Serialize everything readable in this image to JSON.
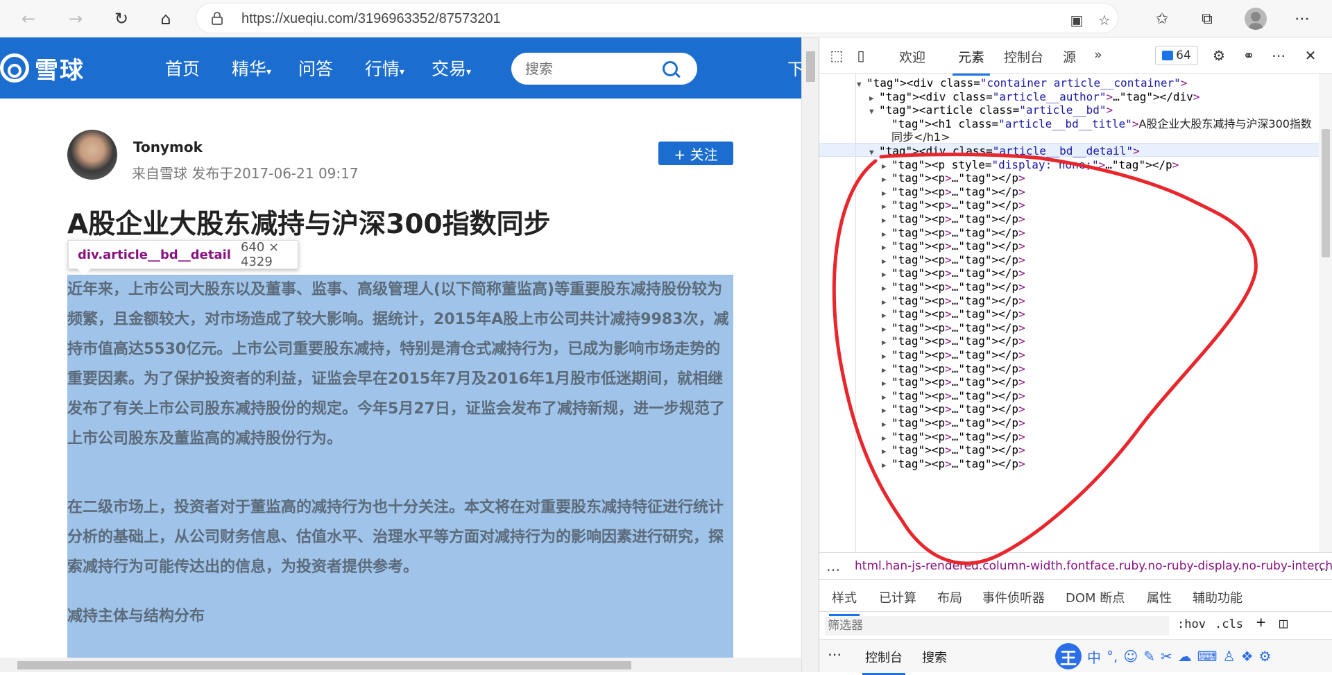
{
  "browser": {
    "url": "https://xueqiu.com/3196963352/87573201"
  },
  "site": {
    "logo_text": "雪球",
    "nav": [
      "首页",
      "精华",
      "问答",
      "行情",
      "交易"
    ],
    "nav_has_dropdown": [
      false,
      true,
      false,
      true,
      true
    ],
    "search_placeholder": "搜索",
    "header_clip": "下"
  },
  "article": {
    "author": "Tonymok",
    "meta": "来自雪球  发布于2017-06-21 09:17",
    "follow_label": "+ 关注",
    "title": "A股企业大股东减持与沪深300指数同步",
    "paragraphs": [
      "近年来，上市公司大股东以及董事、监事、高级管理人(以下简称董监高)等重要股东减持股份较为频繁，且金额较大，对市场造成了较大影响。据统计，2015年A股上市公司共计减持9983次，减持市值高达5530亿元。上市公司重要股东减持，特别是清仓式减持行为，已成为影响市场走势的重要因素。为了保护投资者的利益，证监会早在2015年7月及2016年1月股市低迷期间，就相继发布了有关上市公司股东减持股份的规定。今年5月27日，证监会发布了减持新规，进一步规范了上市公司股东及董监高的减持股份行为。",
      "在二级市场上，投资者对于董监高的减持行为也十分关注。本文将在对重要股东减持特征进行统计分析的基础上，从公司财务信息、估值水平、治理水平等方面对减持行为的影响因素进行研究，探索减持行为可能传达出的信息，为投资者提供参考。",
      "减持主体与结构分布"
    ]
  },
  "inspector_tooltip": {
    "selector": "div.article__bd__detail",
    "size": "640 × 4329"
  },
  "devtools": {
    "tabs": [
      "欢迎",
      "元素",
      "控制台",
      "源"
    ],
    "active_tab": "元素",
    "more": "»",
    "issues_count": "64",
    "dom_lines": [
      {
        "indent": 0,
        "arrow": "▼",
        "html": "<div class=\"container article__container\">"
      },
      {
        "indent": 1,
        "arrow": "▶",
        "html": "<div class=\"article__author\">…</div>"
      },
      {
        "indent": 1,
        "arrow": "▼",
        "html": "<article class=\"article__bd\">"
      },
      {
        "indent": 2,
        "arrow": "",
        "html": "<h1 class=\"article__bd__title\">",
        "text": "A股企业大股东减持与沪深300指数"
      },
      {
        "indent": 2,
        "arrow": "",
        "html": "",
        "text": "同步</h1>"
      },
      {
        "indent": 1,
        "arrow": "▼",
        "html": "<div class=\"article__bd__detail\">"
      },
      {
        "indent": 2,
        "arrow": "▶",
        "html": "<p style=\"display: none;\">…</p>"
      }
    ],
    "p_collapsed": "<p>…</p>",
    "p_count": 22,
    "breadcrumb": "html.han-js-rendered.column-width.fontface.ruby.no-ruby-display.no-ruby-intercha",
    "breadcrumb_dots": "…",
    "style_tabs": [
      "样式",
      "已计算",
      "布局",
      "事件侦听器",
      "DOM 断点",
      "属性",
      "辅助功能"
    ],
    "filter_placeholder": "筛选器",
    "filter_hov": ":hov",
    "filter_cls": ".cls",
    "filter_plus": "+",
    "drawer_dots": "⋯",
    "drawer_tabs": [
      "控制台",
      "搜索"
    ],
    "ime": {
      "logo": "王",
      "mode": "中"
    }
  },
  "colors": {
    "brand": "#1c6dd0",
    "highlight": "#9fc3e9",
    "annotation": "#e8262c"
  }
}
